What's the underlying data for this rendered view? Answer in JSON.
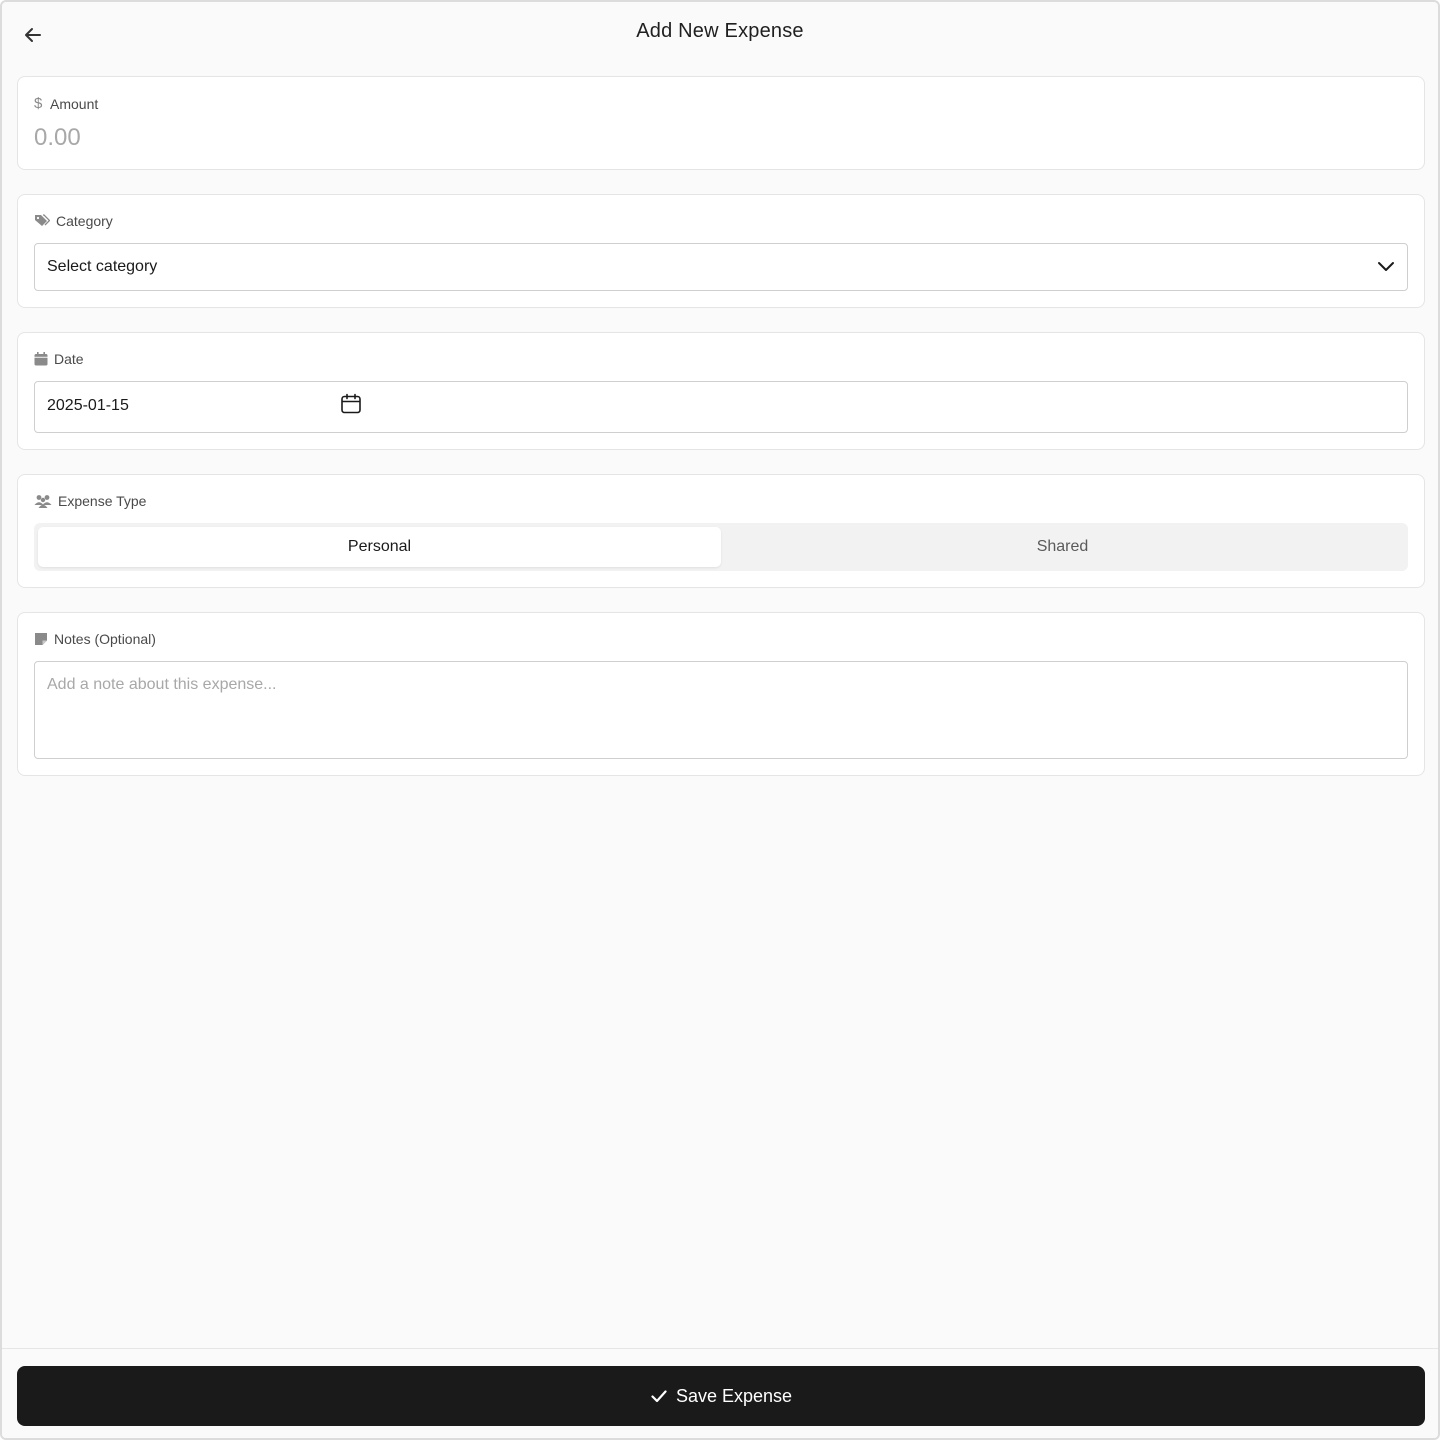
{
  "header": {
    "title": "Add New Expense",
    "back_icon": "arrow-left-icon"
  },
  "amount": {
    "label": "Amount",
    "icon": "dollar-icon",
    "placeholder": "0.00"
  },
  "category": {
    "label": "Category",
    "icon": "tags-icon",
    "selected": "Select category",
    "chevron_icon": "chevron-down-icon"
  },
  "date": {
    "label": "Date",
    "icon": "calendar-icon",
    "value": "2025-01-15",
    "picker_icon": "calendar-outline-icon"
  },
  "expense_type": {
    "label": "Expense Type",
    "icon": "users-icon",
    "options": [
      "Personal",
      "Shared"
    ],
    "selected": "Personal"
  },
  "notes": {
    "label": "Notes (Optional)",
    "icon": "sticky-note-icon",
    "placeholder": "Add a note about this expense..."
  },
  "footer": {
    "save_label": "Save Expense",
    "save_icon": "check-icon"
  },
  "colors": {
    "background": "#fafafa",
    "card": "#ffffff",
    "primary_button": "#1a1a1a",
    "placeholder": "#a8a8a8"
  }
}
